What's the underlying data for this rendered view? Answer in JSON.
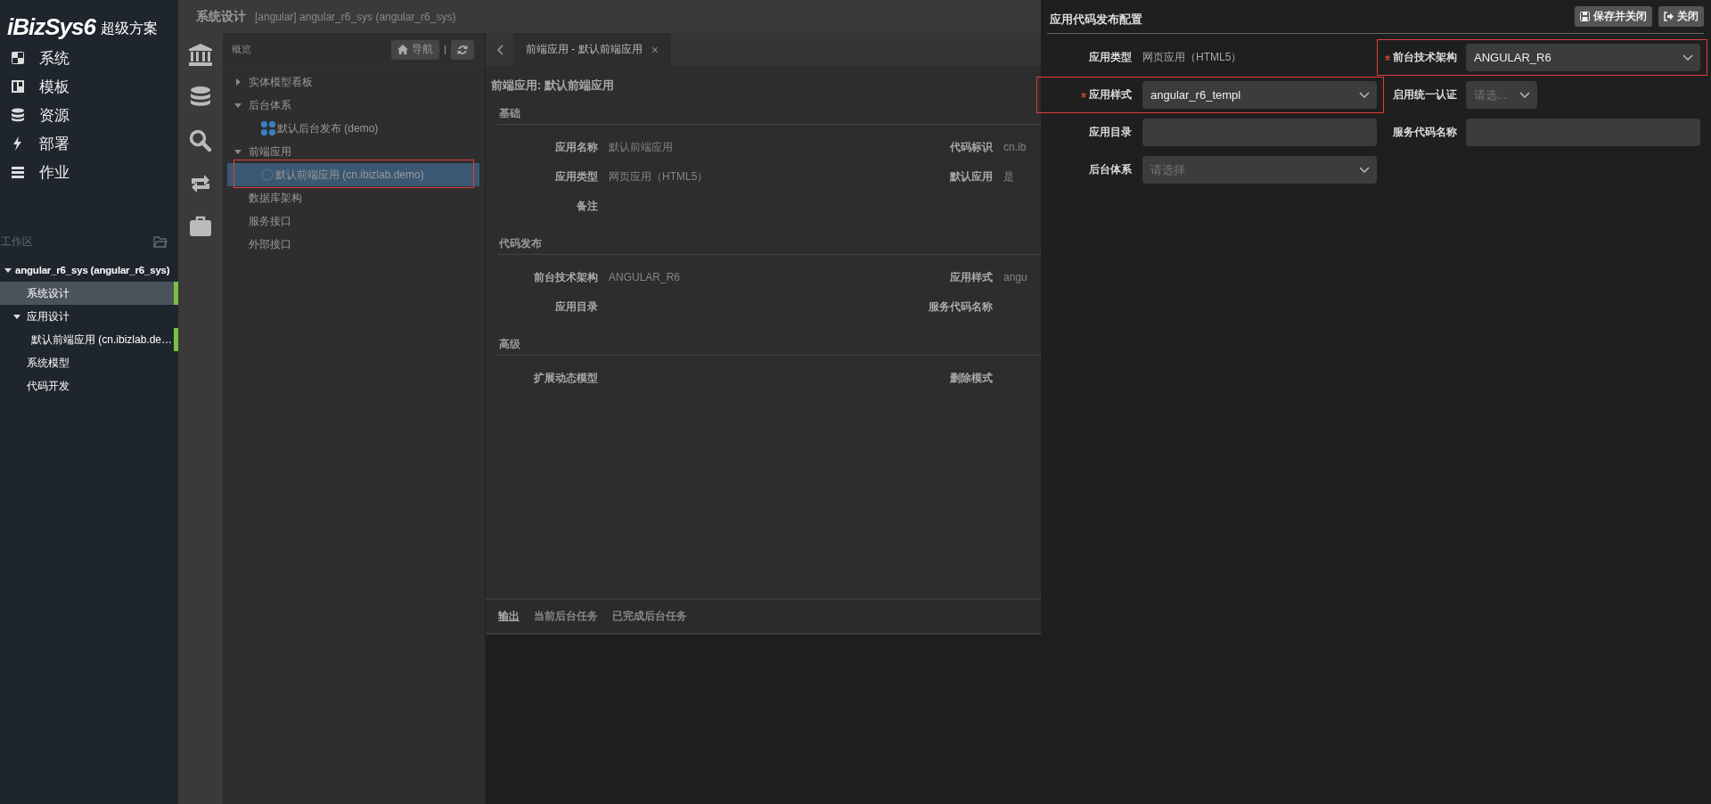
{
  "logo": {
    "brand": "iBizSys6",
    "subtitle": "超级方案"
  },
  "nav": [
    {
      "label": "系统"
    },
    {
      "label": "模板"
    },
    {
      "label": "资源"
    },
    {
      "label": "部署"
    },
    {
      "label": "作业"
    }
  ],
  "workspace": {
    "label": "工作区"
  },
  "workspace_tree": [
    {
      "label": "angular_r6_sys (angular_r6_sys)",
      "expanded": true,
      "selected": false,
      "open": false,
      "children": [
        {
          "label": "系统设计",
          "selected": true,
          "open": true
        },
        {
          "label": "应用设计",
          "expanded": true,
          "selected": false,
          "open": false,
          "children": [
            {
              "label": "默认前端应用 (cn.ibizlab.de…",
              "selected": false,
              "open": true
            }
          ]
        },
        {
          "label": "系统模型",
          "selected": false,
          "open": false
        },
        {
          "label": "代码开发",
          "selected": false,
          "open": false
        }
      ]
    }
  ],
  "header": {
    "title": "系统设计",
    "subtitle": "[angular] angular_r6_sys (angular_r6_sys)"
  },
  "overview": {
    "title": "概览",
    "nav_button": "导航"
  },
  "model_tree": [
    {
      "label": "实体模型看板",
      "expanded": false,
      "selected": false,
      "highlighted": false
    },
    {
      "label": "后台体系",
      "expanded": true,
      "selected": false,
      "highlighted": false,
      "children": [
        {
          "label": "默认后台发布 (demo)",
          "selected": false,
          "highlighted": false
        }
      ]
    },
    {
      "label": "前端应用",
      "expanded": true,
      "selected": false,
      "highlighted": false,
      "children": [
        {
          "label": "默认前端应用 (cn.ibizlab.demo)",
          "selected": true,
          "highlighted": true
        }
      ]
    },
    {
      "label": "数据库架构",
      "selected": false,
      "highlighted": false
    },
    {
      "label": "服务接口",
      "selected": false,
      "highlighted": false
    },
    {
      "label": "外部接口",
      "selected": false,
      "highlighted": false
    }
  ],
  "tab": {
    "label": "前端应用 - 默认前端应用",
    "close": "×"
  },
  "form": {
    "title": "前端应用: 默认前端应用",
    "sections": [
      {
        "title": "基础",
        "rows": [
          [
            {
              "label": "应用名称",
              "value": "默认前端应用"
            },
            {
              "label": "代码标识",
              "value": "cn.ib"
            }
          ],
          [
            {
              "label": "应用类型",
              "value": "网页应用（HTML5）"
            },
            {
              "label": "默认应用",
              "value": "是"
            }
          ],
          [
            {
              "label": "备注"
            }
          ]
        ]
      },
      {
        "title": "代码发布",
        "rows": [
          [
            {
              "label": "前台技术架构",
              "value": "ANGULAR_R6"
            },
            {
              "label": "应用样式",
              "value": "angu"
            }
          ],
          [
            {
              "label": "应用目录"
            },
            {
              "label": "服务代码名称"
            }
          ]
        ]
      },
      {
        "title": "高级",
        "rows": [
          [
            {
              "label": "扩展动态模型"
            },
            {
              "label": "删除模式"
            }
          ]
        ]
      }
    ]
  },
  "bottom_tabs": [
    {
      "label": "输出",
      "selected": true
    },
    {
      "label": "当前后台任务",
      "selected": false
    },
    {
      "label": "已完成后台任务",
      "selected": false
    }
  ],
  "drawer": {
    "title": "应用代码发布配置",
    "buttons": [
      {
        "label": "保存并关闭"
      },
      {
        "label": "关闭"
      }
    ],
    "fields": [
      {
        "kind": "text",
        "label": "应用类型",
        "value": "网页应用（HTML5）",
        "required": false,
        "highlighted": false
      },
      {
        "kind": "select",
        "label": "前台技术架构",
        "value": "ANGULAR_R6",
        "required": true,
        "highlighted": true
      },
      {
        "kind": "select",
        "label": "应用样式",
        "value": "angular_r6_templ",
        "required": true,
        "highlighted": true
      },
      {
        "kind": "small-select",
        "label": "启用统一认证",
        "placeholder": "请选...",
        "required": false,
        "highlighted": false
      },
      {
        "kind": "input",
        "label": "应用目录",
        "required": false,
        "highlighted": false
      },
      {
        "kind": "input",
        "label": "服务代码名称",
        "required": false,
        "highlighted": false
      },
      {
        "kind": "select",
        "label": "后台体系",
        "placeholder": "请选择",
        "required": false,
        "highlighted": false
      }
    ]
  }
}
